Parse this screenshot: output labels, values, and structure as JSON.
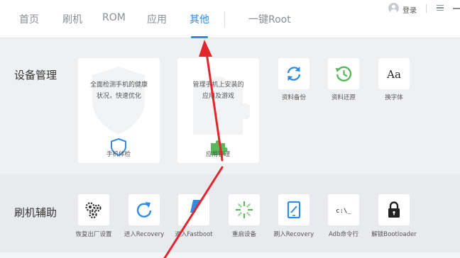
{
  "nav": {
    "tabs": [
      "首页",
      "刷机",
      "ROM",
      "应用",
      "其他",
      "一键Root"
    ],
    "active_tab": "其他",
    "login_label": "登录"
  },
  "device_section": {
    "title": "设备管理",
    "cards": [
      {
        "desc_line1": "全面检测手机的健康",
        "desc_line2": "状况，快速优化",
        "label": "手机体检",
        "icon": "shield-icon"
      },
      {
        "desc_line1": "管理手机上安装的",
        "desc_line2": "应用及游戏",
        "label": "应用管理",
        "icon": "puzzle-icon"
      }
    ],
    "tools": [
      {
        "label": "资料备份",
        "icon": "sync-arrows-icon"
      },
      {
        "label": "资料还原",
        "icon": "clock-restore-icon"
      },
      {
        "label": "换字体",
        "icon": "font-aa-icon",
        "glyph": "Aa"
      }
    ]
  },
  "flash_section": {
    "title": "刷机辅助",
    "tools": [
      {
        "label": "恢复出厂设置",
        "icon": "gears-icon"
      },
      {
        "label": "进入Recovery",
        "icon": "refresh-arrow-icon"
      },
      {
        "label": "进入Fastboot",
        "icon": "lightning-icon"
      },
      {
        "label": "重启设备",
        "icon": "spinner-icon"
      },
      {
        "label": "刷入Recovery",
        "icon": "tablet-pen-icon"
      },
      {
        "label": "Adb命令行",
        "icon": "terminal-icon",
        "glyph": "c:\\_"
      },
      {
        "label": "解锁Bootloader",
        "icon": "lock-icon"
      }
    ]
  },
  "colors": {
    "accent": "#2e8be6",
    "green": "#59b85c",
    "annotation_red": "#e3262b"
  }
}
